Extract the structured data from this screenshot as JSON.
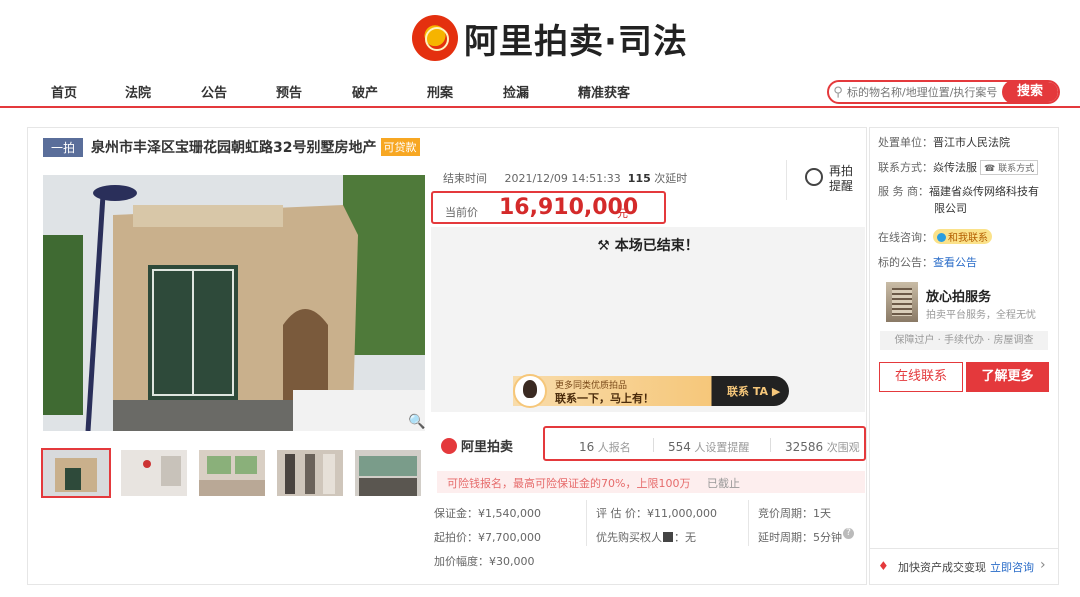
{
  "brand": {
    "logo_text": "阿里拍卖·司法"
  },
  "nav": {
    "items": [
      "首页",
      "法院",
      "公告",
      "预告",
      "破产",
      "刑案",
      "捡漏",
      "精准获客"
    ]
  },
  "search": {
    "placeholder": "标的物名称/地理位置/执行案号",
    "button": "搜索"
  },
  "listing": {
    "round_tag": "一拍",
    "title": "泉州市丰泽区宝珊花园朝虹路32号别墅房地产",
    "loan_tag": "可贷款"
  },
  "auction": {
    "end_label": "结束时间",
    "end_time": "2021/12/09 14:51:33",
    "delay_count": "115",
    "delay_label": "次延时",
    "remind": "再拍提醒",
    "price_label": "当前价",
    "price": "16,910,000",
    "price_unit": "元",
    "ended_text": "本场已结束！"
  },
  "banner": {
    "sub": "更多同类优质拍品",
    "main": "联系一下，马上有！",
    "button": "联系 TA ▶"
  },
  "stats": {
    "brand": "阿里拍卖",
    "signups": "16",
    "signups_label": "人报名",
    "reminders": "554",
    "reminders_label": "人设置提醒",
    "views": "32586",
    "views_label": "次围观"
  },
  "notice": {
    "text": "可险钱报名，最高可险保证金的70%，上限100万",
    "closed": "已截止"
  },
  "details": {
    "deposit": "保证金：¥1,540,000",
    "start_price": "起拍价：¥7,700,000",
    "increment": "加价幅度：¥30,000",
    "appraisal": "评 估 价：¥11,000,000",
    "priority": "优先购买权人",
    "priority_value": "：无",
    "cycle": "竞价周期：1天",
    "delay_cycle": "延时周期：5分钟"
  },
  "sidebar": {
    "unit_label": "处置单位：",
    "unit": "晋江市人民法院",
    "contact_label": "联系方式：",
    "contact": "焱传法服",
    "contact_badge": "联系方式",
    "service_label": "服 务 商：",
    "service_line1": "福建省焱传网络科技有",
    "service_line2": "限公司",
    "consult_label": "在线咨询：",
    "consult_badge": "和我联系",
    "notice_label": "标的公告：",
    "notice_link": "查看公告",
    "svc_title": "放心拍服务",
    "svc_sub": "拍卖平台服务，全程无忧",
    "svc_tags": "保障过户 · 手续代办 · 房屋调查",
    "btn_online": "在线联系",
    "btn_more": "了解更多",
    "bottom_text": "加快资产成交变现",
    "bottom_link": "立即咨询"
  }
}
